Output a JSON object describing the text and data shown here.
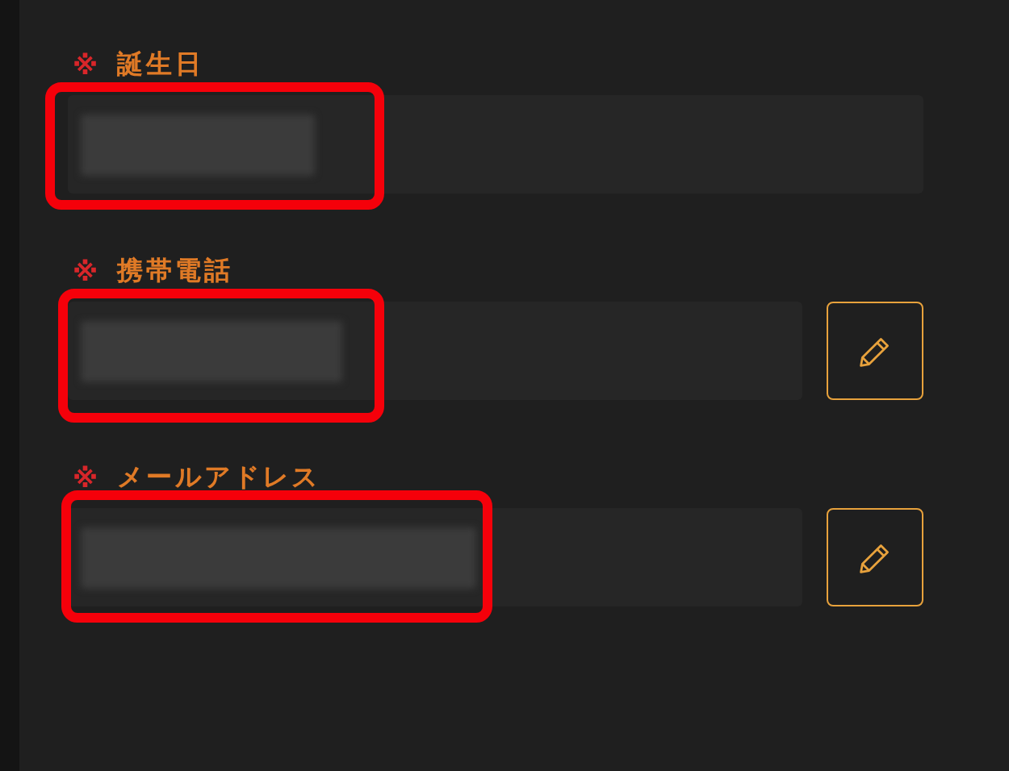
{
  "fields": [
    {
      "mark": "※",
      "label": "誕生日",
      "redacted": true,
      "highlighted": true,
      "editable": false
    },
    {
      "mark": "※",
      "label": "携帯電話",
      "redacted": true,
      "highlighted": true,
      "editable": true
    },
    {
      "mark": "※",
      "label": "メールアドレス",
      "redacted": true,
      "highlighted": true,
      "editable": true
    }
  ]
}
